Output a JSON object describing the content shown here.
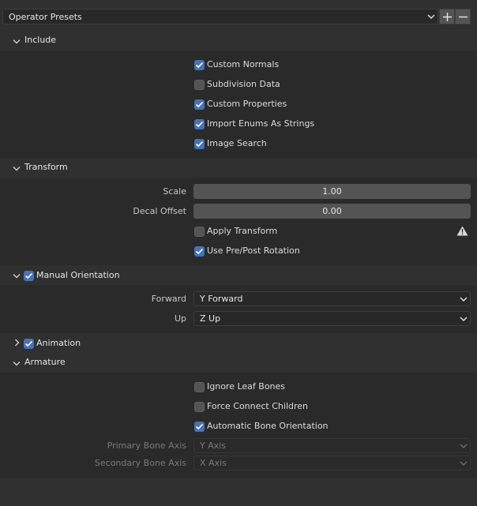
{
  "presets": {
    "label": "Operator Presets",
    "add_symbol": "+",
    "remove_symbol": "−"
  },
  "include": {
    "title": "Include",
    "items": [
      {
        "label": "Custom Normals",
        "checked": true
      },
      {
        "label": "Subdivision Data",
        "checked": false
      },
      {
        "label": "Custom Properties",
        "checked": true
      },
      {
        "label": "Import Enums As Strings",
        "checked": true
      },
      {
        "label": "Image Search",
        "checked": true
      }
    ]
  },
  "transform": {
    "title": "Transform",
    "scale_label": "Scale",
    "scale_value": "1.00",
    "decal_label": "Decal Offset",
    "decal_value": "0.00",
    "apply_transform": {
      "label": "Apply Transform",
      "checked": false
    },
    "pre_post": {
      "label": "Use Pre/Post Rotation",
      "checked": true
    }
  },
  "manual_orientation": {
    "title": "Manual Orientation",
    "enabled": true,
    "forward_label": "Forward",
    "forward_value": "Y Forward",
    "up_label": "Up",
    "up_value": "Z Up"
  },
  "animation": {
    "title": "Animation",
    "enabled": true
  },
  "armature": {
    "title": "Armature",
    "items": [
      {
        "label": "Ignore Leaf Bones",
        "checked": false
      },
      {
        "label": "Force Connect Children",
        "checked": false
      },
      {
        "label": "Automatic Bone Orientation",
        "checked": true
      }
    ],
    "primary_label": "Primary Bone Axis",
    "primary_value": "Y Axis",
    "secondary_label": "Secondary Bone Axis",
    "secondary_value": "X Axis"
  },
  "colors": {
    "accent": "#4772b3",
    "panel_bg": "#2a2a2a",
    "window_bg": "#303030"
  }
}
